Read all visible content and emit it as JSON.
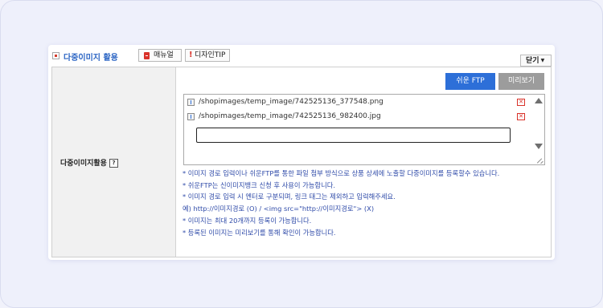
{
  "header": {
    "title": "다중이미지 활용",
    "manual_label": "매뉴얼",
    "design_tip_label": "디자인TIP",
    "close_label": "닫기"
  },
  "field": {
    "label": "다중이미지활용",
    "help_symbol": "?"
  },
  "actions": {
    "ftp_label": "쉬운 FTP",
    "preview_label": "미리보기"
  },
  "files": [
    {
      "path": "/shopimages/temp_image/742525136_377548.png"
    },
    {
      "path": "/shopimages/temp_image/742525136_982400.jpg"
    }
  ],
  "input": {
    "value": ""
  },
  "notes": [
    "* 이미지 경로 입력이나 쉬운FTP를 통한 파일 첨부 방식으로 상품 상세에 노출할 다중이미지를 등록할수 있습니다.",
    "* 쉬운FTP는 신이미지뱅크 신청 후 사용이 가능합니다.",
    "* 이미지 경로 입력 시 엔터로 구분되며, 링크 태그는 제외하고 입력해주세요.",
    "예) http://이미지경로 (O) / <img src=\"http://이미지경로\"> (X)",
    "* 이미지는 최대 20개까지 등록이 가능합니다.",
    "* 등록된 이미지는 미리보기를 통해 확인이 가능합니다."
  ],
  "icons": {
    "title": "image-icon",
    "manual": "document-icon",
    "tip": "exclamation-icon",
    "file": "download-icon",
    "delete": "delete-icon"
  }
}
